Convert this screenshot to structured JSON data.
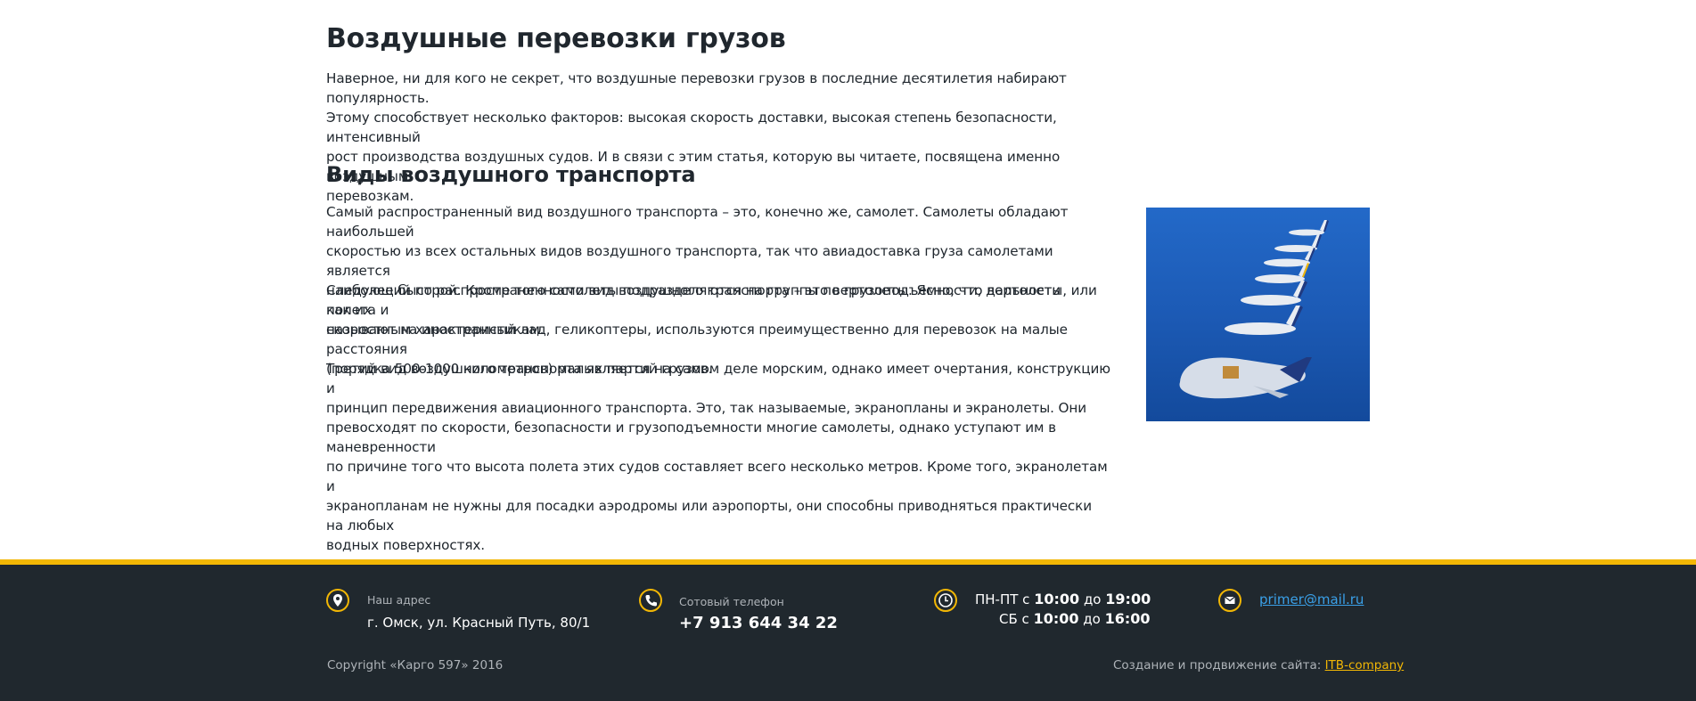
{
  "article": {
    "title": "Воздушные перевозки грузов",
    "intro_lines": [
      "Наверное, ни для кого не секрет, что воздушные перевозки грузов в последние десятилетия набирают популярность.",
      "Этому способствует несколько факторов: высокая скорость доставки, высокая степень безопасности, интенсивный",
      "рост производства воздушных судов. И в связи с этим статья, которую вы читаете, посвящена именно воздушным",
      "перевозкам."
    ],
    "subtitle": "Виды воздушного транспорта",
    "para2_lines": [
      "Самый распространенный вид воздушного транспорта – это, конечно же, самолет. Самолеты обладают наибольшей",
      "скоростью из всех остальных видов воздушного транспорта, так что авиадоставка груза самолетами является",
      "наиболее быстрой. Кроме того самолеты подразделяются на группы по грузоподъемности, дальности полета и",
      "скоростным характеристикам."
    ],
    "para3_lines": [
      "Следующий по распространенности вид воздушного транспорта – это вертолеты. Ясно, что вертолеты, или как их",
      "называют на иностранный лад, геликоптеры, используются преимущественно для перевозок на малые расстояния",
      "(порядка 500-1000 километров) малых партий грузов."
    ],
    "para4_lines": [
      "Третий вид воздушного транспорта является на самом деле морским, однако имеет очертания, конструкцию и",
      "принцип передвижения авиационного транспорта. Это, так называемые, экранопланы и экранолеты. Они",
      "превосходят по скорости, безопасности и грузоподъемности многие самолеты, однако уступают им в маневренности",
      "по причине того что высота полета этих судов составляет всего несколько метров. Кроме того, экранолетам и",
      "экранопланам не нужны для посадки аэродромы или аэропорты, они способны приводняться практически на любых",
      "водных поверхностях."
    ],
    "image_alt": "airplanes"
  },
  "footer": {
    "address_label": "Наш адрес",
    "address_value": "г. Омск, ул. Красный Путь, 80/1",
    "phone_label": "Сотовый телефон",
    "phone_value": "+7 913 644 34 22",
    "hours": {
      "weekday_prefix": "ПН-ПТ с",
      "weekday_from": "10:00",
      "weekday_mid": "до",
      "weekday_to": "19:00",
      "sat_prefix": "СБ с",
      "sat_from": "10:00",
      "sat_mid": "до",
      "sat_to": "16:00"
    },
    "email": "primer@mail.ru",
    "copyright": "Copyright «Карго 597» 2016",
    "credit_prefix": "Создание и продвижение сайта:",
    "credit_link": "ITB-company"
  },
  "colors": {
    "accent": "#f2b705",
    "footer_bg": "#20282e",
    "link": "#3aa0e8",
    "text": "#20272e"
  },
  "icons": [
    "map-pin-icon",
    "phone-icon",
    "clock-icon",
    "mail-icon"
  ]
}
